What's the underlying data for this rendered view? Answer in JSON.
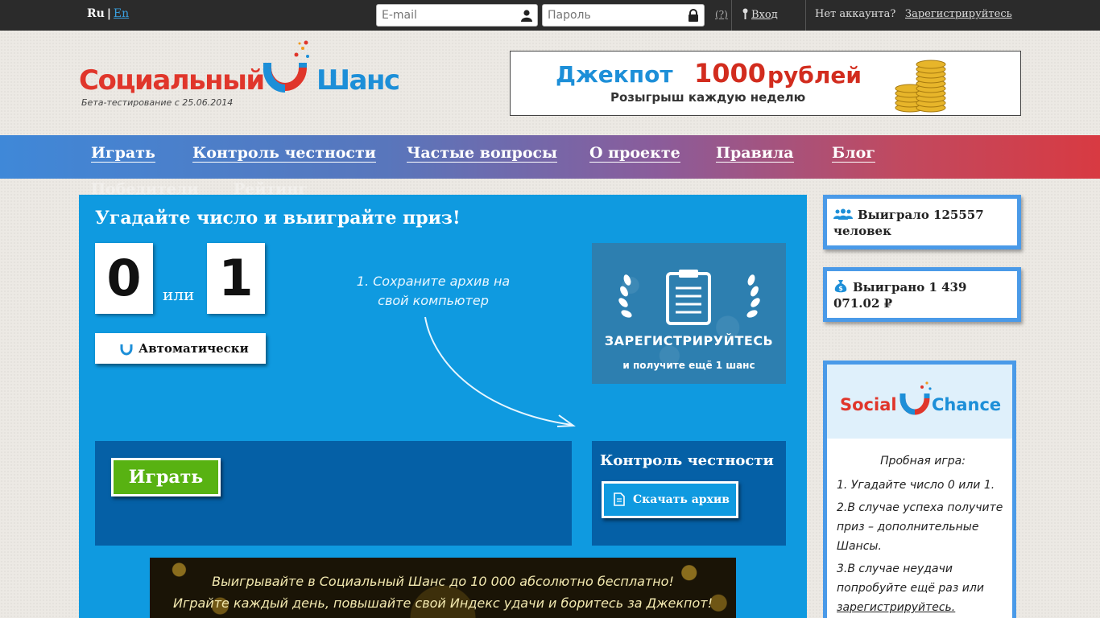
{
  "topbar": {
    "lang_ru": "Ru",
    "lang_sep": "|",
    "lang_en": "En",
    "email_placeholder": "E-mail",
    "password_placeholder": "Пароль",
    "help": "(?)",
    "login": "Вход",
    "no_account": "Нет аккаунта?",
    "register": "Зарегистрируйтесь"
  },
  "logo": {
    "word1": "Социальный",
    "word2": "Шанс",
    "beta": "Бета-тестирование с 25.06.2014"
  },
  "jackpot": {
    "label": "Джекпот",
    "amount": "1000",
    "currency": "рублей",
    "subtitle": "Розыгрыш каждую неделю"
  },
  "nav": {
    "items": [
      "Играть",
      "Контроль честности",
      "Частые вопросы",
      "О проекте",
      "Правила",
      "Блог"
    ],
    "overflow": [
      "Победители",
      "Рейтинг"
    ]
  },
  "game": {
    "title": "Угадайте число и выиграйте приз!",
    "choice_0": "0",
    "choice_or": "или",
    "choice_1": "1",
    "auto_button": "Автоматически",
    "hint": "1. Сохраните архив на свой компьютер",
    "register_promo_title": "ЗАРЕГИСТРИРУЙТЕСЬ",
    "register_promo_sub": "и получите ещё 1 шанс",
    "play_button": "Играть",
    "fairness_title": "Контроль честности",
    "download_button": "Скачать архив",
    "banner_line1": "Выигрывайте в Социальный Шанс до 10 000 абсолютно бесплатно!",
    "banner_line2": "Играйте каждый день, повышайте свой Индекс удачи и боритесь за Джекпот!"
  },
  "stats": {
    "winners": "Выиграло 125557 человек",
    "won_amount": "Выиграно 1 439 071.02 ₽"
  },
  "sidebar_promo": {
    "brand1": "Social",
    "brand2": "Chance",
    "heading": "Пробная игра:",
    "step1": "1. Угадайте число 0 или 1.",
    "step2": "2.В случае успеха получите приз – дополнительные Шансы.",
    "step3_prefix": "3.В случае неудачи попробуйте ещё раз или",
    "step3_link": "зарегистрируйтесь."
  },
  "colors": {
    "topbar_bg": "#2b2b2b",
    "brand_red": "#e0362b",
    "brand_blue": "#1d8fd8",
    "main_bg": "#0f9ae0",
    "panel_dark": "#0560a6",
    "play_green": "#58b212"
  }
}
